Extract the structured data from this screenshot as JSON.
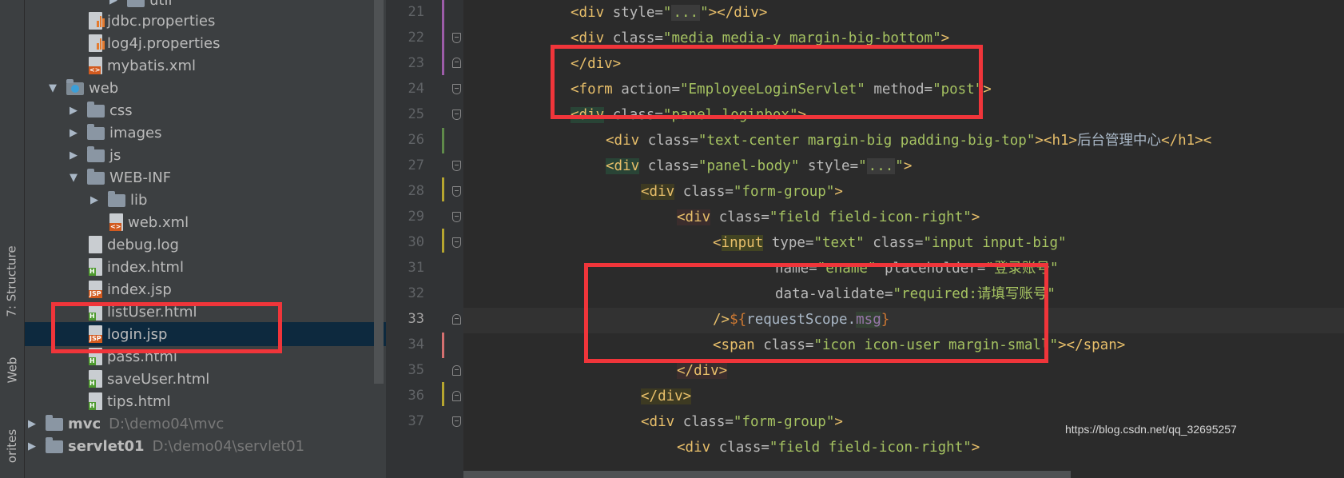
{
  "side_tabs": {
    "structure": "7: Structure",
    "web": "Web",
    "favorites": "orites"
  },
  "tree": {
    "util_label": "util",
    "jdbc": "jdbc.properties",
    "log4j": "log4j.properties",
    "mybatis": "mybatis.xml",
    "web": "web",
    "css": "css",
    "images": "images",
    "js": "js",
    "webinf": "WEB-INF",
    "lib": "lib",
    "webxml": "web.xml",
    "debug": "debug.log",
    "index_html": "index.html",
    "index_jsp": "index.jsp",
    "listuser": "listUser.html",
    "login": "login.jsp",
    "pass": "pass.html",
    "saveuser": "saveUser.html",
    "tips": "tips.html",
    "mvc_name": "mvc",
    "mvc_path": "D:\\demo04\\mvc",
    "servlet_name": "servlet01",
    "servlet_path": "D:\\demo04\\servlet01"
  },
  "lines": [
    "21",
    "22",
    "23",
    "24",
    "25",
    "26",
    "27",
    "28",
    "29",
    "30",
    "31",
    "32",
    "33",
    "34",
    "35",
    "36",
    "37"
  ],
  "current_line": "33",
  "code": {
    "l21": {
      "open": "<div",
      "a1": " style=",
      "v1": "\"",
      "fold": "...",
      "v1b": "\"",
      "close": "></div>"
    },
    "l22": {
      "open": "<div",
      "a1": " class=",
      "v1": "\"media media-y margin-big-bottom\"",
      "close": ">"
    },
    "l23": {
      "tag": "</div>"
    },
    "l24": {
      "open": "<form",
      "a1": " action=",
      "v1": "\"EmployeeLoginServlet\"",
      "a2": " method=",
      "v2": "\"post\"",
      "close": ">"
    },
    "l25": {
      "open": "<div",
      "a1": " class=",
      "v1": "\"panel loginbox\"",
      "close": ">"
    },
    "l26": {
      "open": "<div",
      "a1": " class=",
      "v1": "\"text-center margin-big padding-big-top\"",
      "close": ">",
      "h1o": "<h1>",
      "txt": "后台管理中心",
      "h1c": "</h1><"
    },
    "l27": {
      "open": "<div",
      "a1": " class=",
      "v1": "\"panel-body\"",
      "a2": " style=",
      "v2": "\"",
      "fold": "...",
      "v2b": "\"",
      "close": ">"
    },
    "l28": {
      "open": "<div",
      "a1": " class=",
      "v1": "\"form-group\"",
      "close": ">"
    },
    "l29": {
      "open": "<div",
      "a1": " class=",
      "v1": "\"field field-icon-right\"",
      "close": ">"
    },
    "l30": {
      "lt": "<",
      "name": "input",
      "a1": " type=",
      "v1": "\"text\"",
      "a2": " class=",
      "v2": "\"input input-big\""
    },
    "l31": {
      "a1": "name=",
      "v1": "\"ename\"",
      "a2": " placeholder=",
      "v2": "\"登录账号\""
    },
    "l32": {
      "a1": "data-validate=",
      "v1": "\"required:请填写账号\""
    },
    "l33": {
      "close": "/>",
      "el_open": "${",
      "expr1": "requestScope.",
      "expr2": "msg",
      "el_close": "}"
    },
    "l34": {
      "open": "<span",
      "a1": " class=",
      "v1": "\"icon icon-user margin-small\"",
      "close": "></span>"
    },
    "l35": {
      "tag": "</div>"
    },
    "l36": {
      "tag": "</div>"
    },
    "l37": {
      "open": "<div",
      "a1": " class=",
      "v1": "\"form-group\"",
      "close": ">"
    },
    "l38": {
      "open": "<div",
      "a1": " class=",
      "v1": "\"field field-icon-right\"",
      "close": ">"
    }
  },
  "watermark": "https://blog.csdn.net/qq_32695257",
  "colors": {
    "highlight": "#f0353a",
    "tag": "#e8bf6a",
    "string": "#a5c261",
    "attr": "#bababa",
    "selection": "#0d293e"
  }
}
